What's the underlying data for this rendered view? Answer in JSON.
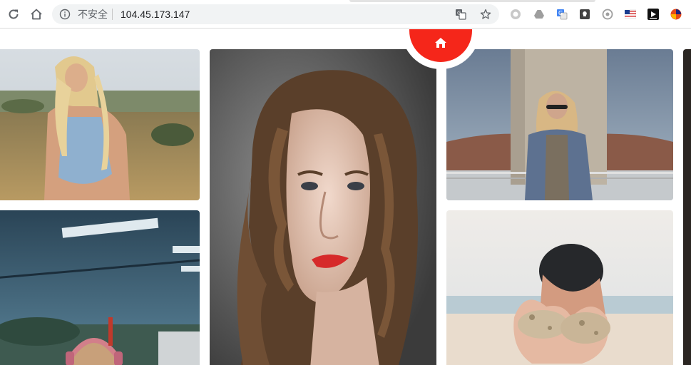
{
  "browser": {
    "security_label": "不安全",
    "url": "104.45.173.147",
    "icons": {
      "reload": "reload-icon",
      "home": "home-icon",
      "info": "info-icon",
      "translate": "translate-icon",
      "bookmark": "star-icon"
    },
    "extensions": [
      "circle-extension-icon",
      "drive-extension-icon",
      "translate-extension-icon",
      "keep-extension-icon",
      "record-extension-icon",
      "flag-extension-icon",
      "media-extension-icon",
      "s-extension-icon"
    ]
  },
  "page": {
    "accent_color": "#f5261a",
    "home_button_icon": "home-icon",
    "gallery": [
      "blonde woman in blue tank top in field",
      "woman with red lips portrait",
      "woman with sunglasses in denim jacket by pillar",
      "woman with headphones under ceiling",
      "hands holding sand on beach"
    ]
  }
}
